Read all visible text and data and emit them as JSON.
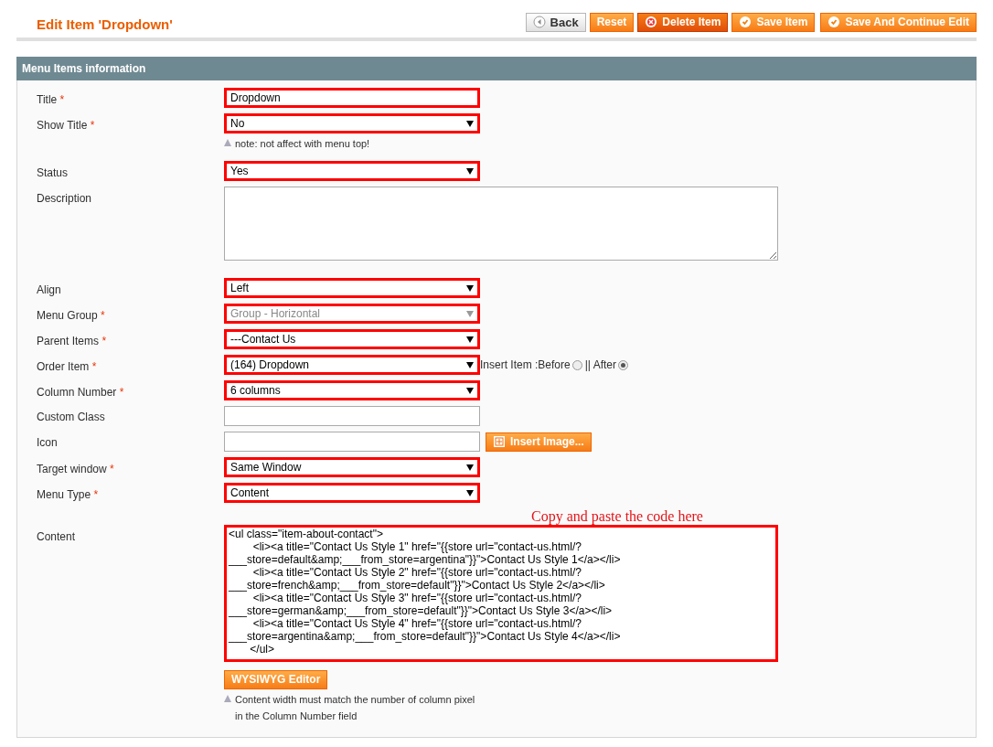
{
  "header": {
    "title": "Edit Item 'Dropdown'"
  },
  "buttons": [
    {
      "label": "Back",
      "kind": "back"
    },
    {
      "label": "Reset",
      "kind": "plain"
    },
    {
      "label": "Delete Item",
      "kind": "delete"
    },
    {
      "label": "Save Item",
      "kind": "save"
    },
    {
      "label": "Save And Continue Edit",
      "kind": "save"
    }
  ],
  "section": {
    "title": "Menu Items information"
  },
  "fields": [
    {
      "label": "Title",
      "required_mark": "*",
      "kind": "text",
      "value": "Dropdown",
      "highlighted": true
    },
    {
      "label": "Show Title",
      "required_mark": "*",
      "kind": "select",
      "value": "No",
      "highlighted": true,
      "note": "note: not affect with menu top!"
    },
    {
      "label": "Status",
      "kind": "select",
      "value": "Yes",
      "highlighted": true
    },
    {
      "label": "Description",
      "kind": "textarea",
      "highlighted": false
    },
    {
      "label": "Align",
      "kind": "select",
      "value": "Left",
      "highlighted": true
    },
    {
      "label": "Menu Group",
      "required_mark": "*",
      "kind": "select",
      "value": "Group - Horizontal",
      "highlighted": true,
      "disabled": true
    },
    {
      "label": "Parent Items",
      "required_mark": "*",
      "kind": "select",
      "value": "---Contact Us",
      "highlighted": true
    },
    {
      "label": "Order Item",
      "required_mark": "*",
      "kind": "select",
      "value": "(164) Dropdown",
      "highlighted": true,
      "insert": {
        "label": "Insert Item : ",
        "options": [
          {
            "label": "Before",
            "selected": false
          },
          {
            "label": "|| After",
            "selected": true
          }
        ]
      }
    },
    {
      "label": "Column Number",
      "required_mark": "*",
      "kind": "select",
      "value": "6 columns",
      "highlighted": true
    },
    {
      "label": "Custom Class",
      "kind": "text",
      "highlighted": false
    },
    {
      "label": "Icon",
      "kind": "text",
      "highlighted": false,
      "action": "Insert Image..."
    },
    {
      "label": "Target window",
      "required_mark": "*",
      "kind": "select",
      "value": "Same Window",
      "highlighted": true
    },
    {
      "label": "Menu Type",
      "required_mark": "*",
      "kind": "select",
      "value": "Content",
      "highlighted": true
    },
    {
      "label": "Content",
      "kind": "code",
      "highlighted": true,
      "annotation": "Copy and paste the code here",
      "value": "<ul class=\"item-about-contact\">\n\t\t<li><a title=\"Contact Us Style 1\" href=\"{{store url=\"contact-us.html/?___store=default&amp;___from_store=argentina\"}}\">Contact Us Style 1</a></li>\n\t\t<li><a title=\"Contact Us Style 2\" href=\"{{store url=\"contact-us.html/?___store=french&amp;___from_store=default\"}}\">Contact Us Style 2</a></li>\n\t\t<li><a title=\"Contact Us Style 3\" href=\"{{store url=\"contact-us.html/?___store=german&amp;___from_store=default\"}}\">Contact Us Style 3</a></li>\n\t\t<li><a title=\"Contact Us Style 4\" href=\"{{store url=\"contact-us.html/?___store=argentina&amp;___from_store=default\"}}\">Contact Us Style 4</a></li>\n       </ul>",
      "action": "WYSIWYG Editor",
      "note_lines": [
        "Content width must match the number of column pixel",
        "in the Column Number field"
      ]
    }
  ]
}
